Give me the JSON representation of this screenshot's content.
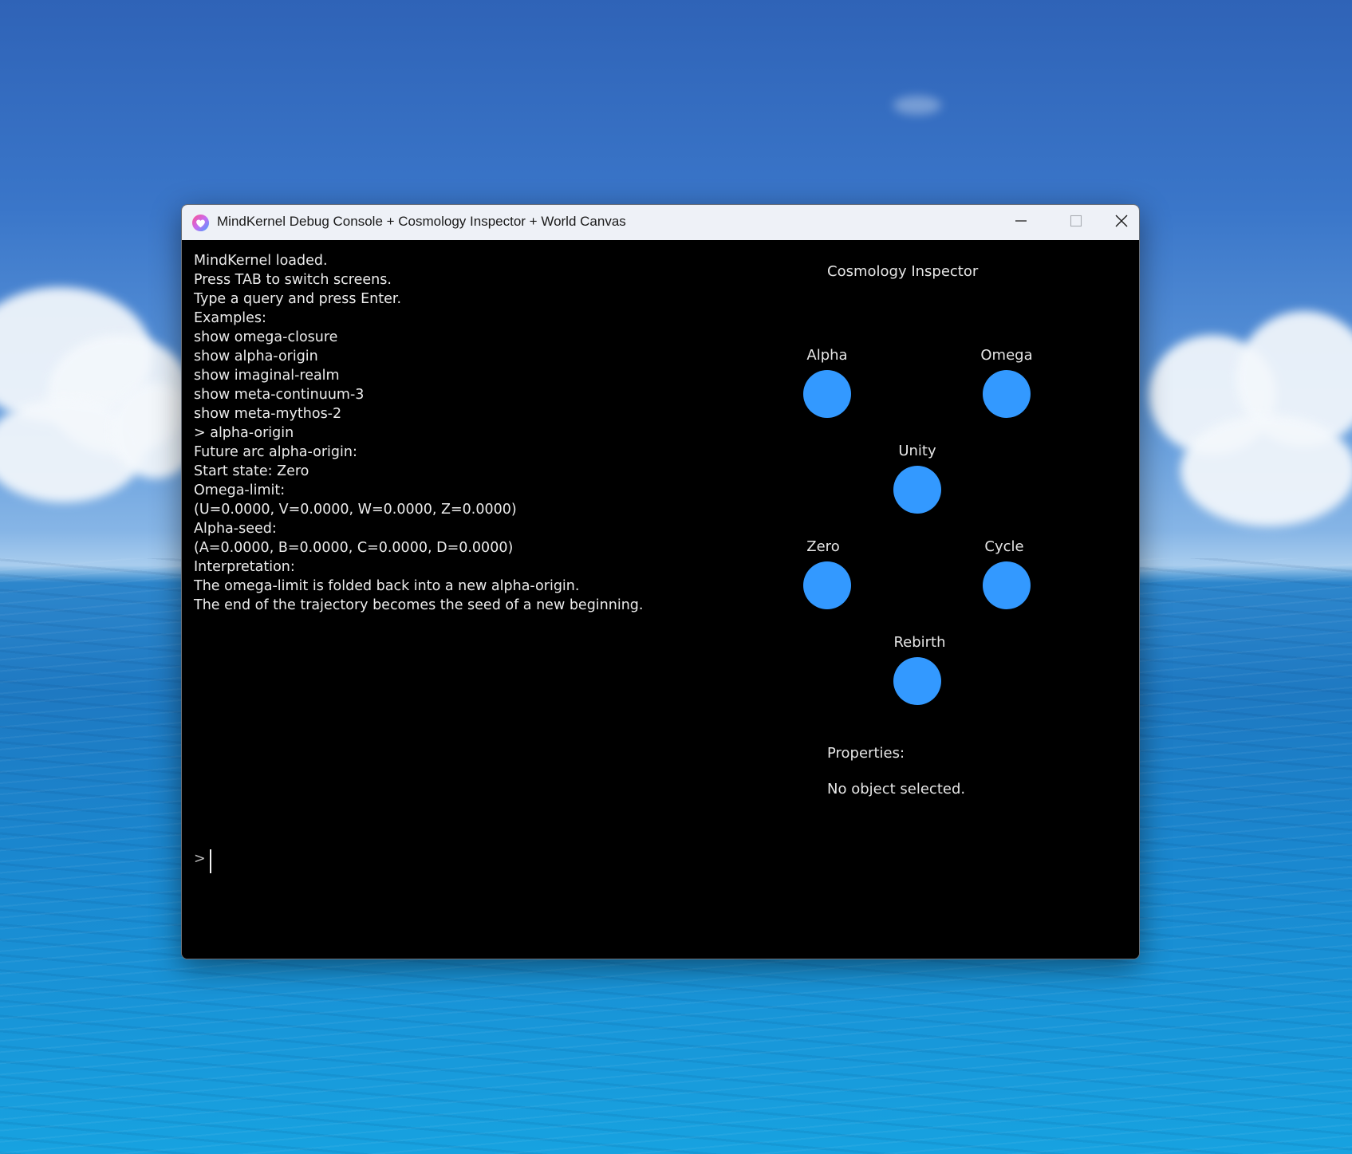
{
  "window": {
    "title": "MindKernel Debug Console + Cosmology Inspector + World Canvas",
    "icon": "app-heart-icon",
    "controls": {
      "minimize": "minimize-icon",
      "maximize": "maximize-icon",
      "close": "close-icon"
    }
  },
  "console": {
    "lines": [
      "MindKernel loaded.",
      "Press TAB to switch screens.",
      "Type a query and press Enter.",
      "Examples:",
      "show omega-closure",
      "show alpha-origin",
      "show imaginal-realm",
      "show meta-continuum-3",
      "show meta-mythos-2",
      "> alpha-origin",
      "Future arc alpha-origin:",
      "Start state: Zero",
      "Omega-limit:",
      "(U=0.0000, V=0.0000, W=0.0000, Z=0.0000)",
      "Alpha-seed:",
      "(A=0.0000, B=0.0000, C=0.0000, D=0.0000)",
      "Interpretation:",
      "The omega-limit is folded back into a new alpha-origin.",
      "The end of the trajectory becomes the seed of a new beginning."
    ],
    "prompt_symbol": ">",
    "input_value": ""
  },
  "inspector": {
    "title": "Cosmology Inspector",
    "nodes": [
      {
        "label": "Alpha"
      },
      {
        "label": "Omega"
      },
      {
        "label": "Unity"
      },
      {
        "label": "Zero"
      },
      {
        "label": "Cycle"
      },
      {
        "label": "Rebirth"
      }
    ],
    "node_color": "#3399ff",
    "properties_label": "Properties:",
    "properties_value": "No object selected."
  },
  "colors": {
    "console_bg": "#000000",
    "console_text": "#ececec",
    "titlebar_bg": "#eef1f7"
  }
}
